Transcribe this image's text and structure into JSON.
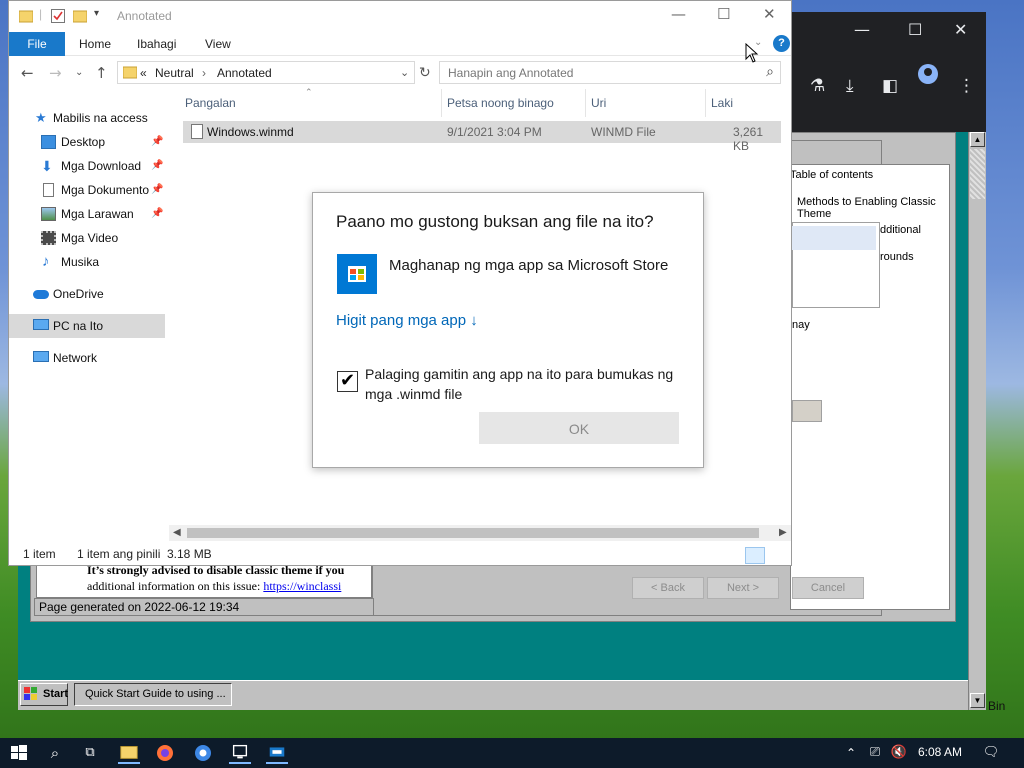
{
  "explorer": {
    "window_title": "Annotated",
    "ribbon_tabs": [
      "File",
      "Home",
      "Ibahagi",
      "View"
    ],
    "breadcrumb": [
      "«",
      "Neutral",
      "›",
      "Annotated"
    ],
    "search_placeholder": "Hanapin ang Annotated",
    "nav_items": [
      {
        "label": "Mabilis na access",
        "icon": "star-icon",
        "pinned": false
      },
      {
        "label": "Desktop",
        "icon": "desktop-icon",
        "pinned": true
      },
      {
        "label": "Mga Download",
        "icon": "download-icon",
        "pinned": true
      },
      {
        "label": "Mga Dokumento",
        "icon": "document-icon",
        "pinned": true
      },
      {
        "label": "Mga Larawan",
        "icon": "pictures-icon",
        "pinned": true
      },
      {
        "label": "Mga Video",
        "icon": "video-icon",
        "pinned": false
      },
      {
        "label": "Musika",
        "icon": "music-icon",
        "pinned": false
      },
      {
        "label": "OneDrive",
        "icon": "cloud-icon",
        "pinned": false
      },
      {
        "label": "PC na Ito",
        "icon": "computer-icon",
        "pinned": false
      },
      {
        "label": "Network",
        "icon": "network-icon",
        "pinned": false
      }
    ],
    "columns": [
      "Pangalan",
      "Petsa noong binago",
      "Uri",
      "Laki"
    ],
    "files": [
      {
        "name": "Windows.winmd",
        "date": "9/1/2021 3:04 PM",
        "type": "WINMD File",
        "size": "3,261 KB"
      }
    ],
    "status": {
      "count": "1 item",
      "selected": "1 item ang pinili",
      "size": "3.18 MB"
    }
  },
  "dialog": {
    "title": "Paano mo gustong buksan ang file na ito?",
    "store_option": "Maghanap ng mga app sa Microsoft Store",
    "more_apps": "Higit pang mga app ↓",
    "always_use": "Palaging gamitin ang app na ito para bumukas ng mga .winmd file",
    "always_use_checked": true,
    "ok": "OK"
  },
  "background_doc": {
    "toc_title": "Table of contents",
    "toc_line1": "Methods to Enabling Classic",
    "toc_line2": "Theme",
    "toc_frag_additional": "dditional",
    "toc_frag_rounds": "rounds",
    "toc_frag_may": "nay",
    "advice_text": "It’s strongly advised to disable classic theme if you",
    "info_text": "additional information on this issue: ",
    "info_link": "https://winclassi",
    "page_generated": "Page generated on 2022-06-12 19:34",
    "buttons": [
      "< Back",
      "Next >",
      "Cancel"
    ]
  },
  "classic_taskbar": {
    "start": "Start",
    "task": "Quick Start Guide to using ..."
  },
  "bin_label": "Bin",
  "taskbar": {
    "time": "6:08 AM"
  },
  "colors": {
    "accent": "#1979ca",
    "link": "#0067b8",
    "teal_desktop": "#008080",
    "taskbar": "#0d1b2a"
  }
}
